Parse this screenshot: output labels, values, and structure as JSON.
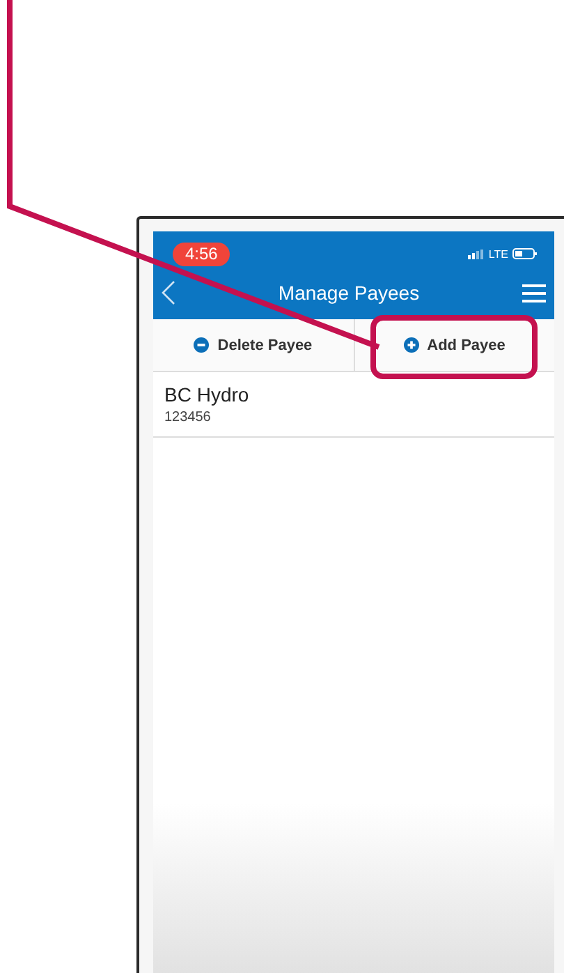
{
  "status_bar": {
    "time": "4:56",
    "network": "LTE"
  },
  "nav_bar": {
    "title": "Manage Payees"
  },
  "actions": [
    {
      "label": "Delete Payee",
      "kind": "remove"
    },
    {
      "label": "Add Payee",
      "kind": "add"
    }
  ],
  "payees": [
    {
      "name": "BC Hydro",
      "number": "123456"
    }
  ]
}
